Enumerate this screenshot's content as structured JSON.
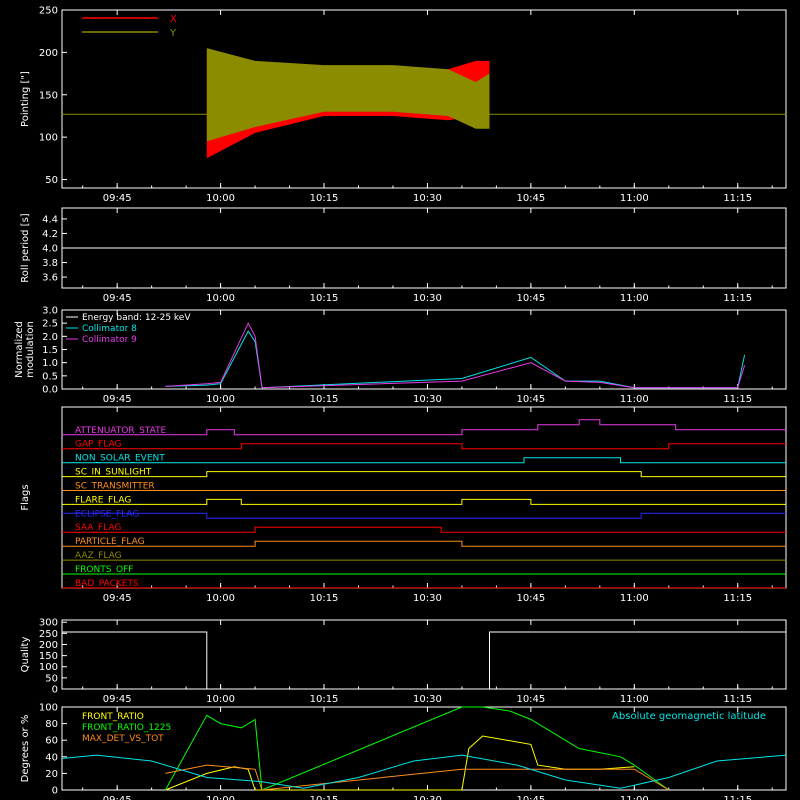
{
  "colors": {
    "axis": "#ffffff",
    "x_red": "#ff0000",
    "y_olive": "#8c8c00",
    "cyan": "#00e5e5",
    "magenta": "#e53be5",
    "yellow": "#ffff00",
    "green": "#00ff00",
    "orange": "#ff8c1a",
    "blue": "#2a2aff",
    "gray": "#888888"
  },
  "time_axis": {
    "range": [
      "09:37",
      "11:22"
    ],
    "ticks": [
      "09:45",
      "10:00",
      "10:15",
      "10:30",
      "10:45",
      "11:00",
      "11:15"
    ]
  },
  "chart_data": [
    {
      "type": "area",
      "ylabel": "Pointing [\"]",
      "ylim": [
        40,
        250
      ],
      "yticks": [
        "50",
        "100",
        "150",
        "200",
        "250"
      ],
      "legend_position": "top-left",
      "series": [
        {
          "name": "X",
          "color_key": "x_red",
          "x": [
            "09:58",
            "10:05",
            "10:15",
            "10:25",
            "10:33",
            "10:37",
            "10:39"
          ],
          "low": [
            75,
            105,
            125,
            125,
            120,
            125,
            130
          ],
          "high": [
            200,
            175,
            170,
            178,
            180,
            190,
            190
          ]
        },
        {
          "name": "Y",
          "color_key": "y_olive",
          "x": [
            "09:58",
            "10:05",
            "10:15",
            "10:25",
            "10:33",
            "10:37",
            "10:39"
          ],
          "low": [
            95,
            112,
            130,
            130,
            125,
            110,
            110
          ],
          "high": [
            205,
            190,
            185,
            185,
            180,
            165,
            175
          ]
        }
      ],
      "baseline": 127
    },
    {
      "type": "line",
      "ylabel": "Roll period [s]",
      "ylim": [
        3.45,
        4.55
      ],
      "yticks": [
        "3.6",
        "3.8",
        "4.0",
        "4.2",
        "4.4"
      ],
      "series": [
        {
          "name": "",
          "x": [
            "09:37",
            "11:22"
          ],
          "values": [
            4.0,
            4.0
          ]
        }
      ]
    },
    {
      "type": "line",
      "ylabel": "Normalized modulation",
      "ylim": [
        0,
        3
      ],
      "yticks": [
        "0.0",
        "0.5",
        "1.0",
        "1.5",
        "2.0",
        "2.5",
        "3.0"
      ],
      "legend": [
        "Energy band: 12-25 keV",
        "Collimator 8",
        "Collimator 9"
      ],
      "legend_position": "top-left",
      "series": [
        {
          "name": "Collimator 8",
          "color_key": "cyan",
          "x": [
            "09:52",
            "09:58",
            "10:00",
            "10:04",
            "10:05",
            "10:06",
            "10:35",
            "10:45",
            "10:50",
            "10:55",
            "11:00",
            "11:15",
            "11:16"
          ],
          "values": [
            0.1,
            0.15,
            0.2,
            2.2,
            1.8,
            0.05,
            0.4,
            1.2,
            0.3,
            0.3,
            0.05,
            0.05,
            1.3
          ]
        },
        {
          "name": "Collimator 9",
          "color_key": "magenta",
          "x": [
            "09:52",
            "09:58",
            "10:00",
            "10:04",
            "10:05",
            "10:06",
            "10:35",
            "10:45",
            "10:50",
            "10:55",
            "11:00",
            "11:15",
            "11:16"
          ],
          "values": [
            0.1,
            0.2,
            0.25,
            2.5,
            2.0,
            0.05,
            0.3,
            1.0,
            0.3,
            0.25,
            0.05,
            0.05,
            0.9
          ]
        }
      ]
    },
    {
      "type": "table",
      "ylabel": "Flags",
      "rows": [
        {
          "label": "ATTENUATOR_STATE",
          "color_key": "magenta",
          "segments": [
            [
              "09:37",
              "09:58",
              0
            ],
            [
              "09:58",
              "10:02",
              1
            ],
            [
              "10:02",
              "10:35",
              0
            ],
            [
              "10:35",
              "10:46",
              1
            ],
            [
              "10:46",
              "10:52",
              2
            ],
            [
              "10:52",
              "10:55",
              3
            ],
            [
              "10:55",
              "11:06",
              2
            ],
            [
              "11:06",
              "11:22",
              1
            ]
          ]
        },
        {
          "label": "GAP_FLAG",
          "color_key": "x_red",
          "segments": [
            [
              "09:37",
              "10:03",
              0
            ],
            [
              "10:03",
              "10:35",
              1
            ],
            [
              "10:35",
              "11:05",
              0
            ],
            [
              "11:05",
              "11:22",
              1
            ]
          ]
        },
        {
          "label": "NON_SOLAR_EVENT",
          "color_key": "cyan",
          "segments": [
            [
              "09:37",
              "10:44",
              0
            ],
            [
              "10:44",
              "10:58",
              1
            ],
            [
              "10:58",
              "11:22",
              0
            ]
          ]
        },
        {
          "label": "SC_IN_SUNLIGHT",
          "color_key": "yellow",
          "segments": [
            [
              "09:37",
              "09:58",
              0
            ],
            [
              "09:58",
              "11:01",
              1
            ],
            [
              "11:01",
              "11:22",
              0
            ]
          ]
        },
        {
          "label": "SC_TRANSMITTER",
          "color_key": "orange",
          "segments": [
            [
              "09:37",
              "11:22",
              0
            ]
          ]
        },
        {
          "label": "FLARE_FLAG",
          "color_key": "yellow",
          "segments": [
            [
              "09:37",
              "09:58",
              0
            ],
            [
              "09:58",
              "10:03",
              1
            ],
            [
              "10:03",
              "10:35",
              0
            ],
            [
              "10:35",
              "10:45",
              1
            ],
            [
              "10:45",
              "11:22",
              0
            ]
          ]
        },
        {
          "label": "ECLIPSE_FLAG",
          "color_key": "blue",
          "segments": [
            [
              "09:37",
              "09:58",
              1
            ],
            [
              "09:58",
              "11:01",
              0
            ],
            [
              "11:01",
              "11:22",
              1
            ]
          ]
        },
        {
          "label": "SAA_FLAG",
          "color_key": "x_red",
          "segments": [
            [
              "09:37",
              "10:05",
              0
            ],
            [
              "10:05",
              "10:32",
              1
            ],
            [
              "10:32",
              "11:22",
              0
            ]
          ]
        },
        {
          "label": "PARTICLE_FLAG",
          "color_key": "orange",
          "segments": [
            [
              "09:37",
              "10:05",
              0
            ],
            [
              "10:05",
              "10:35",
              1
            ],
            [
              "10:35",
              "11:22",
              0
            ]
          ]
        },
        {
          "label": "AAZ_FLAG",
          "color_key": "y_olive",
          "segments": [
            [
              "09:37",
              "11:22",
              0
            ]
          ]
        },
        {
          "label": "FRONTS_OFF",
          "color_key": "green",
          "segments": [
            [
              "09:37",
              "11:22",
              0
            ]
          ]
        },
        {
          "label": "BAD_PACKETS",
          "color_key": "x_red",
          "segments": [
            [
              "09:37",
              "11:22",
              0
            ]
          ]
        }
      ]
    },
    {
      "type": "line",
      "ylabel": "Quality",
      "ylim": [
        0,
        310
      ],
      "yticks": [
        "0",
        "50",
        "100",
        "150",
        "200",
        "250",
        "300"
      ],
      "series": [
        {
          "name": "",
          "x": [
            "09:37",
            "09:58",
            "09:58",
            "10:39",
            "10:39",
            "11:22"
          ],
          "values": [
            256,
            256,
            0,
            0,
            256,
            256
          ]
        }
      ]
    },
    {
      "type": "line",
      "ylabel": "Degrees or %",
      "ylim": [
        0,
        100
      ],
      "yticks": [
        "0",
        "20",
        "40",
        "60",
        "80",
        "100"
      ],
      "legend_position": "top-left",
      "annotation": "Absolute geomagnetic latitude",
      "series": [
        {
          "name": "FRONT_RATIO",
          "color_key": "yellow",
          "x": [
            "09:52",
            "09:58",
            "10:02",
            "10:04",
            "10:05",
            "10:35",
            "10:36",
            "10:38",
            "10:45",
            "10:46",
            "10:50",
            "10:55",
            "11:00"
          ],
          "values": [
            0,
            20,
            28,
            25,
            0,
            0,
            50,
            65,
            55,
            30,
            25,
            25,
            28
          ]
        },
        {
          "name": "FRONT_RATIO_1225",
          "color_key": "green",
          "x": [
            "09:52",
            "09:58",
            "10:00",
            "10:03",
            "10:05",
            "10:06",
            "10:35",
            "10:38",
            "10:42",
            "10:45",
            "10:48",
            "10:52",
            "10:58",
            "11:00",
            "11:05"
          ],
          "values": [
            0,
            90,
            80,
            75,
            85,
            0,
            100,
            100,
            95,
            85,
            70,
            50,
            40,
            30,
            0
          ]
        },
        {
          "name": "MAX_DET_VS_TOT",
          "color_key": "orange",
          "x": [
            "09:52",
            "09:58",
            "10:05",
            "10:06",
            "10:35",
            "10:45",
            "10:55",
            "11:00",
            "11:05"
          ],
          "values": [
            20,
            30,
            25,
            0,
            25,
            25,
            25,
            25,
            0
          ]
        },
        {
          "name": "Absolute geomagnetic latitude",
          "color_key": "cyan",
          "x": [
            "09:37",
            "09:42",
            "09:50",
            "09:58",
            "10:06",
            "10:12",
            "10:20",
            "10:28",
            "10:35",
            "10:43",
            "10:50",
            "10:58",
            "11:05",
            "11:12",
            "11:22"
          ],
          "values": [
            38,
            42,
            35,
            15,
            10,
            2,
            15,
            35,
            42,
            30,
            12,
            2,
            15,
            35,
            42
          ]
        }
      ]
    }
  ]
}
